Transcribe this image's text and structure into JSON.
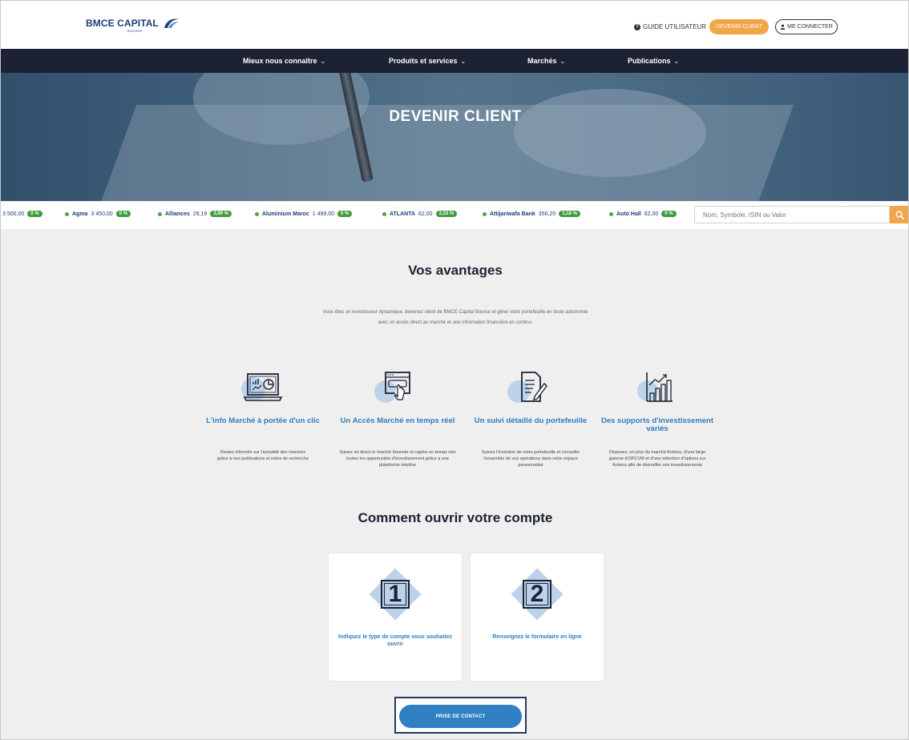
{
  "header": {
    "logo": {
      "name": "BMCE CAPITAL",
      "sub": "BOURSE"
    },
    "guide_label": "GUIDE UTILISATEUR",
    "devenir_client_label": "DEVENIR CLIENT",
    "connect_label": "ME CONNECTER"
  },
  "nav": {
    "items": [
      {
        "label": "Mieux nous connaître"
      },
      {
        "label": "Produits et services"
      },
      {
        "label": "Marchés"
      },
      {
        "label": "Publications"
      }
    ],
    "chevron": "⌄"
  },
  "hero": {
    "title": "DEVENIR CLIENT"
  },
  "ticker": {
    "items": [
      {
        "name": "",
        "value": "3 500,00",
        "change": "0 %"
      },
      {
        "name": "Agma",
        "value": "3 450,00",
        "change": "0 %"
      },
      {
        "name": "Alliances",
        "value": "29,19",
        "change": "3,99 %"
      },
      {
        "name": "Aluminium Maroc",
        "value": "1 499,00",
        "change": "0 %"
      },
      {
        "name": "ATLANTA",
        "value": "62,00",
        "change": "3,33 %"
      },
      {
        "name": "Attijariwafa Bank",
        "value": "356,20",
        "change": "1,18 %"
      },
      {
        "name": "Auto Hall",
        "value": "62,00",
        "change": "0 %"
      }
    ],
    "search_placeholder": "Nom, Symbole, ISIN ou Valor"
  },
  "avantages": {
    "title": "Vos avantages",
    "intro_line1": "Vous êtes un investisseur dynamique, devenez client de BMCE Capital Bourse et gérer votre portefeuille en toute autonomie",
    "intro_line2": "avec un accès direct au marché et une information financière en continu.",
    "features": [
      {
        "icon": "laptop-chart-icon",
        "title": "L'info Marché à portée d'un clic",
        "desc": "Restez informés sur l'actualité des marchés grâce à nos publications et notes de recherche"
      },
      {
        "icon": "browser-click-icon",
        "title": "Un Accès Marché en temps réel",
        "desc": "Suivez en direct le marché boursier et captez en temps réel toutes les opportunités d'investissement grâce à une plateforme intuitive"
      },
      {
        "icon": "document-edit-icon",
        "title": "Un suivi détaillé du portefeuille",
        "desc": "Suivez l'évolution de votre portefeuille et consulter l'ensemble de vos opérations dans votre espace personnalisé"
      },
      {
        "icon": "bar-growth-icon",
        "title": "Des supports d'investissement variés",
        "desc": "Disposez, en plus du marché Actions, d'une large gamme d'OPCVM et d'une sélection d'options sur Actions afin de diversifier vos investissements"
      }
    ]
  },
  "steps": {
    "title": "Comment ouvrir votre compte",
    "items": [
      {
        "number": "1",
        "text": "Indiquez le type de compte vous souhaitez ouvrir"
      },
      {
        "number": "2",
        "text": "Renseignez le formulaire en ligne"
      }
    ],
    "cta_label": "PRISE DE CONTACT"
  },
  "colors": {
    "nav_bg": "#1c2233",
    "accent_orange": "#f1a64a",
    "accent_blue": "#2f7dbd",
    "positive_green": "#3f9b3f"
  }
}
